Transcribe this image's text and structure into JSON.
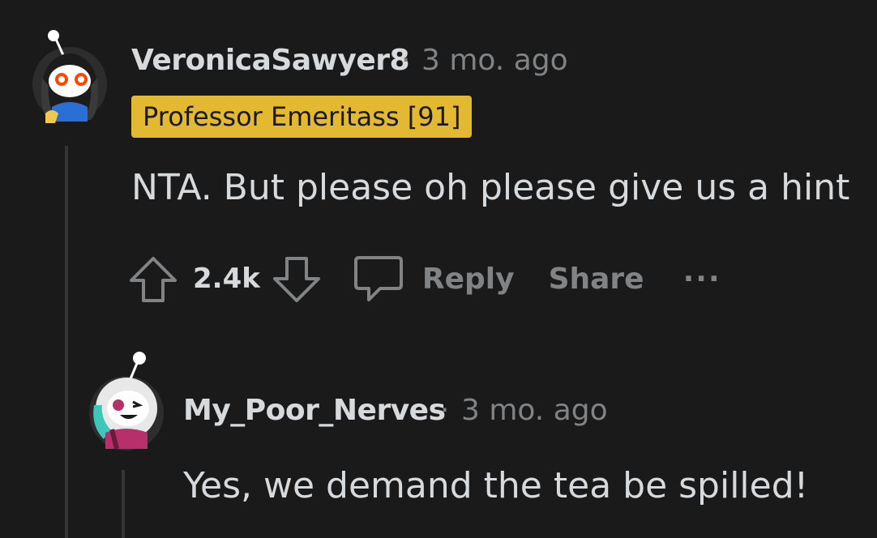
{
  "comments": [
    {
      "username": "VeronicaSawyer8",
      "separator": "·",
      "time": "3 mo. ago",
      "flair": "Professor Emeritass [91]",
      "body": "NTA. But please oh please give us a hint",
      "votes": "2.4k",
      "actions": {
        "reply": "Reply",
        "share": "Share",
        "more": "···"
      },
      "icons": {
        "upvote": "arrow-up-icon",
        "downvote": "arrow-down-icon",
        "comment": "comment-bubble-icon"
      }
    },
    {
      "username": "My_Poor_Nerves",
      "separator": "·",
      "time": "3 mo. ago",
      "body": "Yes, we demand the tea be spilled!"
    }
  ],
  "colors": {
    "background": "#1a1a1b",
    "text": "#d7dadc",
    "muted": "#818384",
    "flair_bg": "#e2b931",
    "thread_line": "#343536"
  }
}
